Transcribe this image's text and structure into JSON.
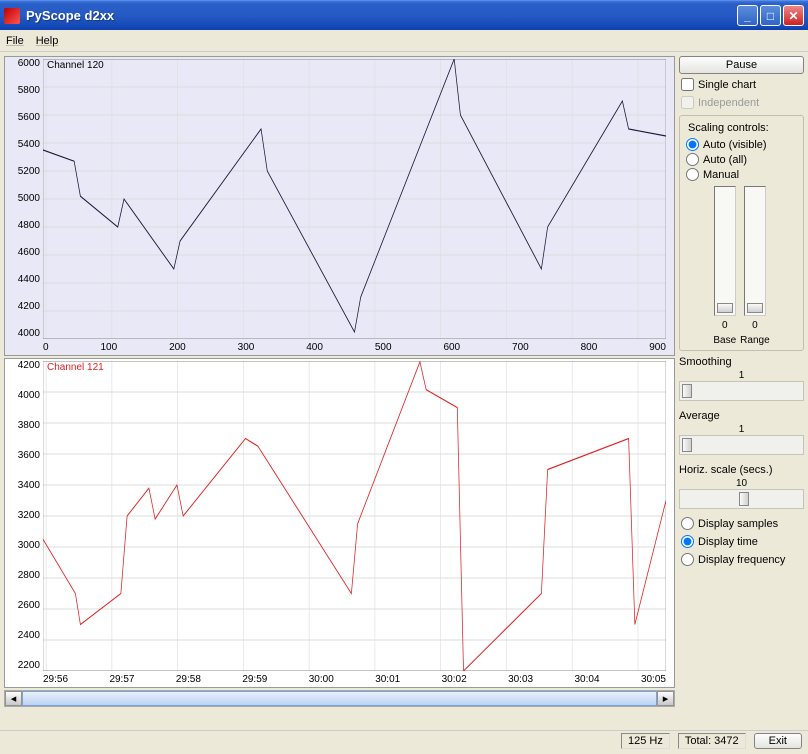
{
  "window": {
    "title": "PyScope d2xx"
  },
  "menu": {
    "file": "File",
    "help": "Help"
  },
  "sidebar": {
    "pause": "Pause",
    "single_chart": "Single chart",
    "independent": "Independent",
    "scaling_legend": "Scaling controls:",
    "auto_visible": "Auto (visible)",
    "auto_all": "Auto (all)",
    "manual": "Manual",
    "base": "Base",
    "range": "Range",
    "base_val": "0",
    "range_val": "0",
    "smoothing": "Smoothing",
    "smoothing_val": "1",
    "average": "Average",
    "average_val": "1",
    "hscale": "Horiz. scale (secs.)",
    "hscale_val": "10",
    "disp_samples": "Display samples",
    "disp_time": "Display time",
    "disp_freq": "Display frequency"
  },
  "status": {
    "hz": "125 Hz",
    "total": "Total: 3472",
    "exit": "Exit"
  },
  "chart_data": [
    {
      "type": "line",
      "title": "Channel 120",
      "color": "#1a1a3a",
      "ylim": [
        4000,
        6000
      ],
      "yticks": [
        6000,
        5800,
        5600,
        5400,
        5200,
        5000,
        4800,
        4600,
        4400,
        4200,
        4000
      ],
      "xticks": [
        0,
        100,
        200,
        300,
        400,
        500,
        600,
        700,
        800,
        900
      ],
      "x": [
        0,
        50,
        60,
        120,
        130,
        210,
        220,
        350,
        360,
        500,
        510,
        660,
        670,
        800,
        810,
        930,
        940,
        1000
      ],
      "values": [
        5350,
        5270,
        5020,
        4800,
        5000,
        4500,
        4700,
        5500,
        5200,
        4050,
        4300,
        6000,
        5600,
        4500,
        4800,
        5700,
        5500,
        5450
      ]
    },
    {
      "type": "line",
      "title": "Channel 121",
      "color": "#d22",
      "ylim": [
        2200,
        4200
      ],
      "yticks": [
        4200,
        4000,
        3800,
        3600,
        3400,
        3200,
        3000,
        2800,
        2600,
        2400,
        2200
      ],
      "xticks": [
        "29:56",
        "29:57",
        "29:58",
        "29:59",
        "30:00",
        "30:01",
        "30:02",
        "30:03",
        "30:04",
        "30:05"
      ],
      "x": [
        0,
        52,
        60,
        125,
        135,
        170,
        180,
        215,
        225,
        325,
        345,
        495,
        505,
        605,
        615,
        665,
        675,
        800,
        810,
        940,
        950,
        1000
      ],
      "values": [
        3050,
        2700,
        2500,
        2700,
        3200,
        3380,
        3180,
        3400,
        3200,
        3700,
        3650,
        2700,
        3150,
        4195,
        4015,
        3900,
        2200,
        2700,
        3500,
        3700,
        2500,
        3300
      ]
    }
  ]
}
